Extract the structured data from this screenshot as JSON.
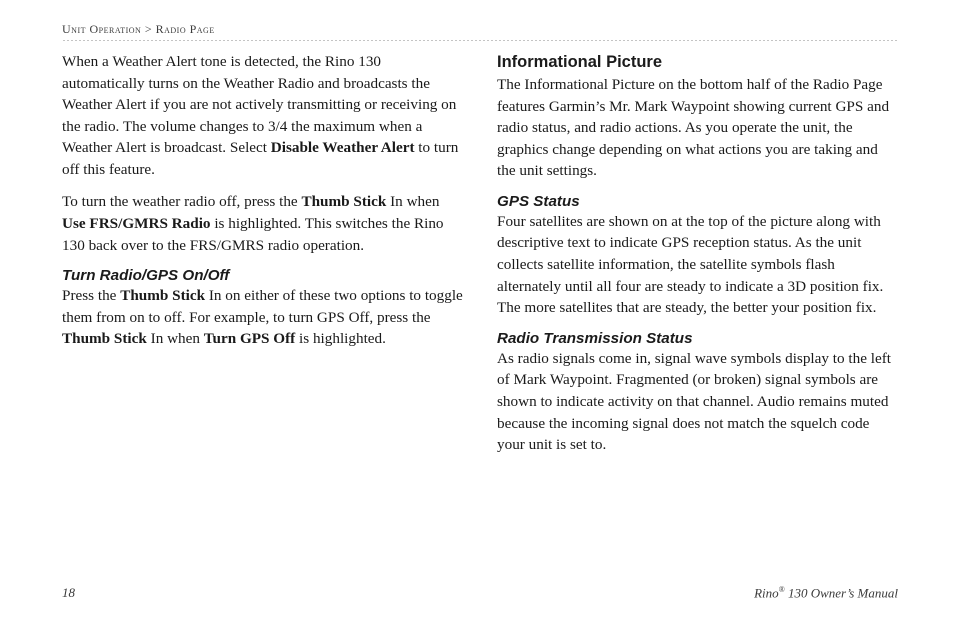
{
  "breadcrumb": {
    "part1": "Unit Operation",
    "sep": " > ",
    "part2": "Radio Page"
  },
  "col1": {
    "p1_a": "When a Weather Alert tone is detected, the Rino 130 automatically turns on the Weather Radio and broadcasts the Weather Alert if you are not actively transmitting or receiving on the radio. The volume changes to 3/4 the maximum when a Weather Alert is broadcast. Select ",
    "p1_b": "Disable Weather Alert",
    "p1_c": " to turn off this feature.",
    "p2_a": "To turn the weather radio off, press the ",
    "p2_b": "Thumb Stick",
    "p2_c": " In when ",
    "p2_d": "Use FRS/GMRS Radio",
    "p2_e": " is highlighted. This switches the Rino 130 back over to the FRS/GMRS radio operation.",
    "h3_1": "Turn Radio/GPS On/Off",
    "p3_a": "Press the ",
    "p3_b": "Thumb Stick",
    "p3_c": " In on either of these two options to toggle them from on to off. For example, to turn GPS Off, press the ",
    "p3_d": "Thumb Stick",
    "p3_e": " In when ",
    "p3_f": "Turn GPS Off",
    "p3_g": " is highlighted."
  },
  "col2": {
    "h2_1": "Informational Picture",
    "p4": "The Informational Picture on the bottom half of the Radio Page features Garmin’s Mr. Mark Waypoint showing current GPS and radio status, and radio actions. As you operate the unit, the graphics change depending on what actions you are taking and the unit settings.",
    "h3_2": "GPS Status",
    "p5": "Four satellites are shown on at the top of the picture along with descriptive text to indicate GPS reception status. As the unit collects satellite information, the satellite symbols flash alternately until all four are steady to indicate a 3D position fix. The more satellites that are steady, the better your position fix.",
    "h3_3": "Radio Transmission Status",
    "p6": "As radio signals come in, signal wave symbols display to the left of Mark Waypoint. Fragmented (or broken) signal symbols are shown to indicate activity on that channel. Audio remains muted because the incoming signal does not match the squelch code your unit is set to."
  },
  "footer": {
    "page": "18",
    "title_a": "Rino",
    "title_sup": "®",
    "title_b": " 130 Owner’s Manual"
  }
}
